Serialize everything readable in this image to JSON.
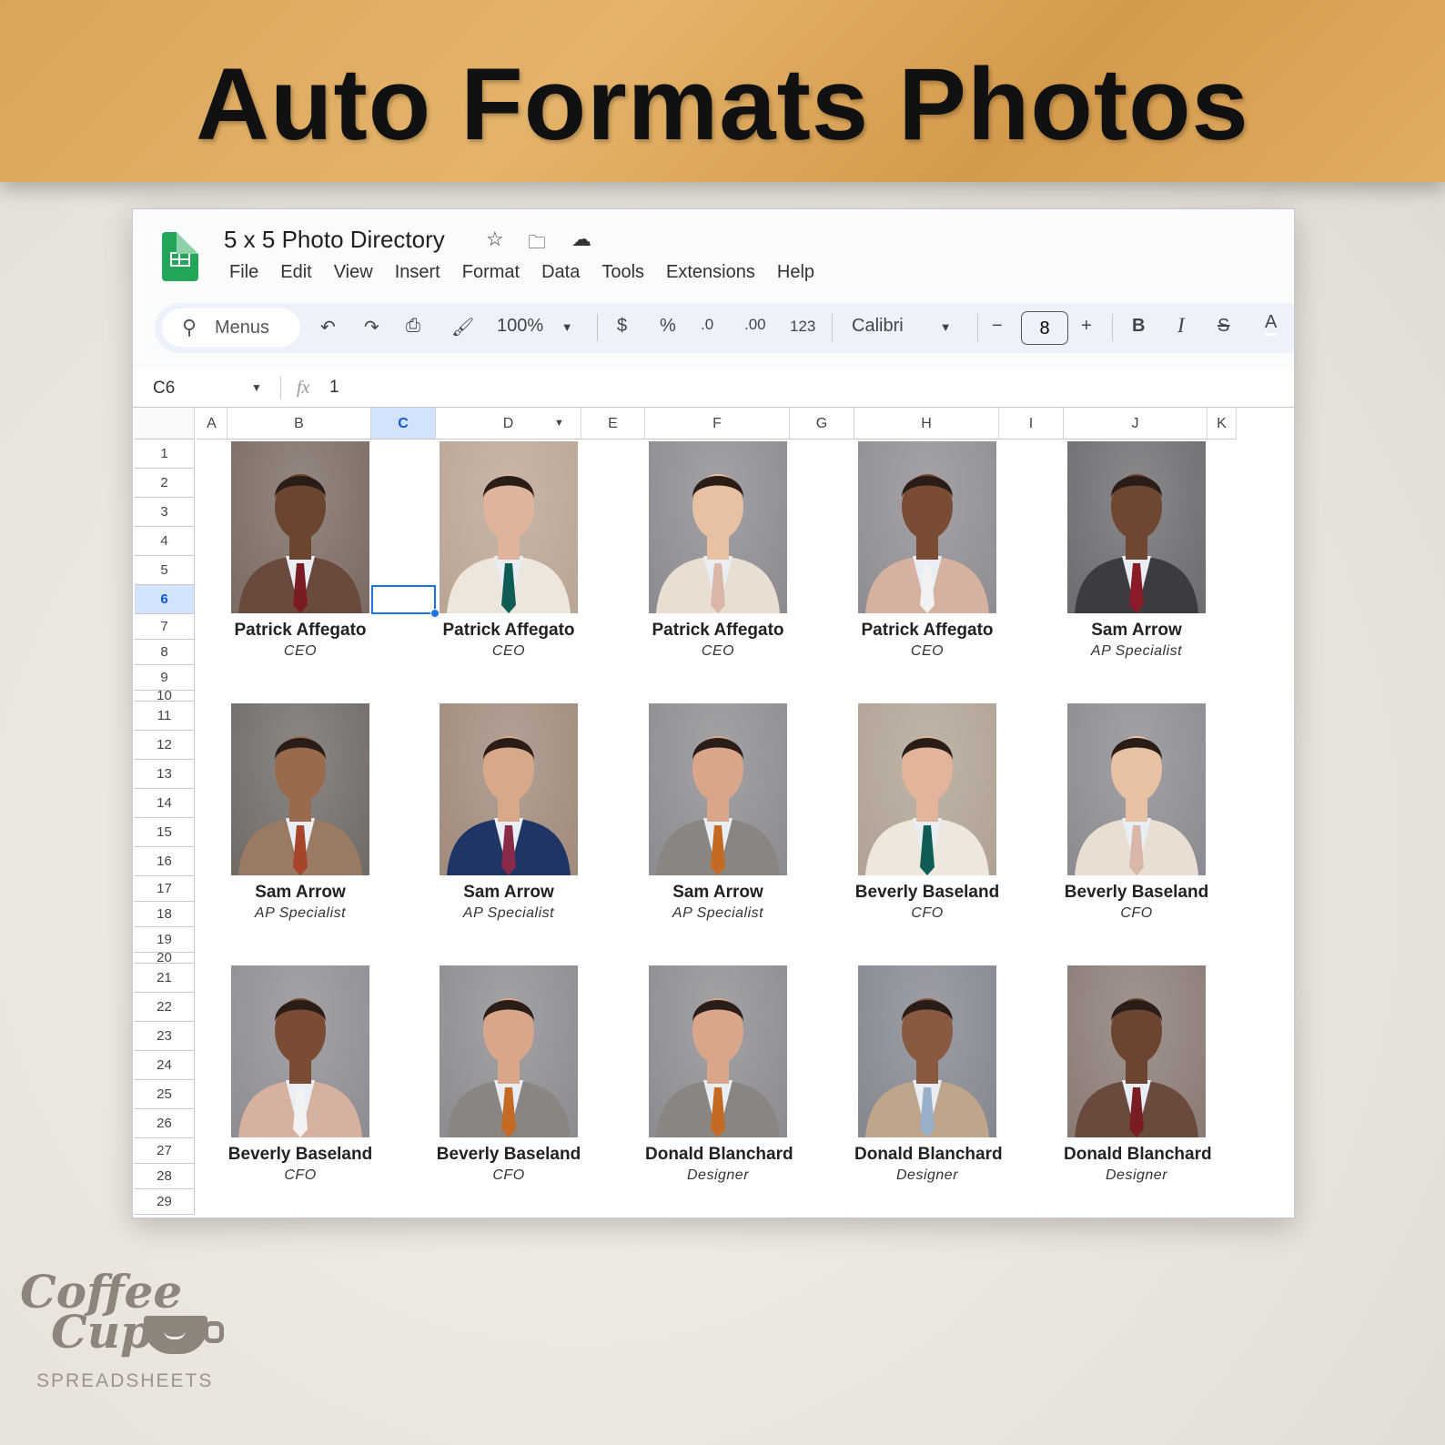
{
  "banner": {
    "title": "Auto Formats Photos"
  },
  "app": {
    "doc_title": "5 x 5 Photo Directory",
    "icons": [
      "star-icon",
      "move-to-folder-icon",
      "cloud-saved-icon"
    ],
    "menu": [
      "File",
      "Edit",
      "View",
      "Insert",
      "Format",
      "Data",
      "Tools",
      "Extensions",
      "Help"
    ]
  },
  "toolbar": {
    "search_label": "Menus",
    "zoom": "100%",
    "currency": "$",
    "percent": "%",
    "dec_decrease": ".0",
    "dec_increase": ".00",
    "number_format": "123",
    "font": "Calibri",
    "font_size": "8",
    "bold": "B",
    "italic": "I",
    "text_color": "A"
  },
  "formula_bar": {
    "cell_ref": "C6",
    "fx": "fx",
    "value": "1"
  },
  "columns": [
    "A",
    "B",
    "C",
    "D",
    "E",
    "F",
    "G",
    "H",
    "I",
    "J",
    "K"
  ],
  "selected_column": "C",
  "selected_row": "6",
  "rows": [
    "1",
    "2",
    "3",
    "4",
    "5",
    "6",
    "7",
    "8",
    "9",
    "10",
    "11",
    "12",
    "13",
    "14",
    "15",
    "16",
    "17",
    "18",
    "19",
    "20",
    "21",
    "22",
    "23",
    "24",
    "25",
    "26",
    "27",
    "28",
    "29"
  ],
  "cards": [
    {
      "name": "Patrick Affegato",
      "title": "CEO",
      "bg": "#7a6a62",
      "suit": "#6b4a3e",
      "skin": "#6b4530",
      "tie": "#7a1c24"
    },
    {
      "name": "Patrick Affegato",
      "title": "CEO",
      "bg": "#b9a594",
      "suit": "#ece6dc",
      "skin": "#e0b49a",
      "tie": "#0f5c55"
    },
    {
      "name": "Patrick Affegato",
      "title": "CEO",
      "bg": "#8b8a90",
      "suit": "#e8dfd2",
      "skin": "#e8c0a2",
      "tie": "#d9b6a8"
    },
    {
      "name": "Patrick Affegato",
      "title": "CEO",
      "bg": "#8f8c92",
      "suit": "#d7b1a0",
      "skin": "#7a4c34",
      "tie": "#f2f2f2"
    },
    {
      "name": "Sam Arrow",
      "title": "AP Specialist",
      "bg": "#6c6b6f",
      "suit": "#3b3b40",
      "skin": "#6e4632",
      "tie": "#8a1c2a"
    },
    {
      "name": "Sam Arrow",
      "title": "AP Specialist",
      "bg": "#6f6a66",
      "suit": "#9a7a62",
      "skin": "#9a6a4c",
      "tie": "#a8432c"
    },
    {
      "name": "Sam Arrow",
      "title": "AP Specialist",
      "bg": "#a08a7c",
      "suit": "#1f3566",
      "skin": "#d8a988",
      "tie": "#8a2a4a"
    },
    {
      "name": "Sam Arrow",
      "title": "AP Specialist",
      "bg": "#8c8c90",
      "suit": "#8a8580",
      "skin": "#d9a68a",
      "tie": "#c46a24"
    },
    {
      "name": "Beverly Baseland",
      "title": "CFO",
      "bg": "#b0a294",
      "suit": "#ede7dd",
      "skin": "#e2b49a",
      "tie": "#0f5c55"
    },
    {
      "name": "Beverly Baseland",
      "title": "CFO",
      "bg": "#8b8a90",
      "suit": "#e8dfd2",
      "skin": "#e8c0a2",
      "tie": "#d9b6a8"
    },
    {
      "name": "Beverly Baseland",
      "title": "CFO",
      "bg": "#8f8c92",
      "suit": "#d7b1a0",
      "skin": "#7a4c34",
      "tie": "#f2f2f2"
    },
    {
      "name": "Beverly Baseland",
      "title": "CFO",
      "bg": "#8c8c90",
      "suit": "#8a8580",
      "skin": "#d9a68a",
      "tie": "#c46a24"
    },
    {
      "name": "Donald Blanchard",
      "title": "Designer",
      "bg": "#8c8c90",
      "suit": "#8a8580",
      "skin": "#d9a68a",
      "tie": "#c46a24"
    },
    {
      "name": "Donald Blanchard",
      "title": "Designer",
      "bg": "#85878f",
      "suit": "#bfa68a",
      "skin": "#8a5a40",
      "tie": "#9ab0c8"
    },
    {
      "name": "Donald Blanchard",
      "title": "Designer",
      "bg": "#8a7a74",
      "suit": "#6b4a3e",
      "skin": "#6b4530",
      "tie": "#7a1c24"
    }
  ],
  "brand": {
    "line1": "Coffee",
    "line2": "Cup",
    "line3": "SPREADSHEETS"
  }
}
